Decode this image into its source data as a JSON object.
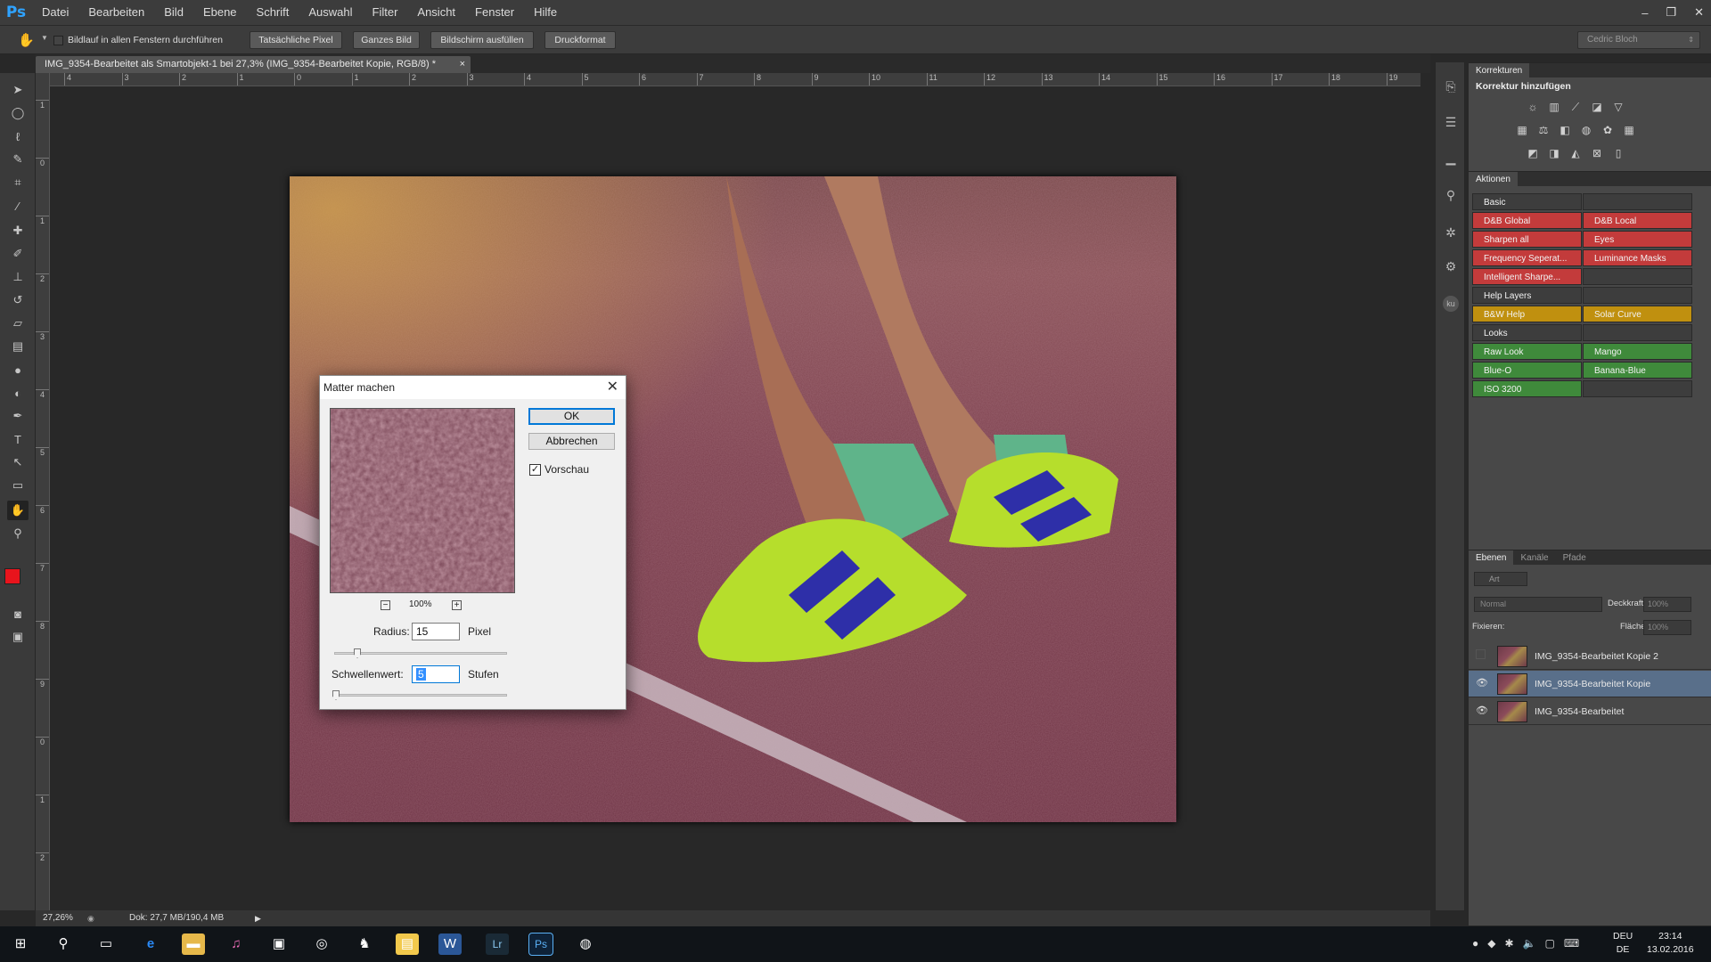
{
  "app": {
    "logo": "Ps"
  },
  "menu": [
    "Datei",
    "Bearbeiten",
    "Bild",
    "Ebene",
    "Schrift",
    "Auswahl",
    "Filter",
    "Ansicht",
    "Fenster",
    "Hilfe"
  ],
  "window_controls": {
    "minimize": "–",
    "restore": "❐",
    "close": "✕"
  },
  "options_bar": {
    "scroll_all_label": "Bildlauf in allen Fenstern durchführen",
    "buttons": [
      "Tatsächliche Pixel",
      "Ganzes Bild",
      "Bildschirm ausfüllen",
      "Druckformat"
    ],
    "user": "Cedric Bloch"
  },
  "document": {
    "tab_title": "IMG_9354-Bearbeitet als Smartobjekt-1 bei 27,3% (IMG_9354-Bearbeitet Kopie, RGB/8) *",
    "tab_close": "×"
  },
  "ruler_h": [
    "4",
    "3",
    "2",
    "1",
    "0",
    "1",
    "2",
    "3",
    "4",
    "5",
    "6",
    "7",
    "8",
    "9",
    "10",
    "11",
    "12",
    "13",
    "14",
    "15",
    "16",
    "17",
    "18",
    "19"
  ],
  "ruler_v": [
    "1",
    "0",
    "1",
    "2",
    "3",
    "4",
    "5",
    "6",
    "7",
    "8",
    "9",
    "0",
    "1",
    "2"
  ],
  "status": {
    "zoom": "27,26%",
    "doc": "Dok: 27,7 MB/190,4 MB"
  },
  "dialog": {
    "title": "Matter machen",
    "ok": "OK",
    "cancel": "Abbrechen",
    "preview_label": "Vorschau",
    "preview_checked": true,
    "zoom": "100%",
    "zoom_minus": "−",
    "zoom_plus": "+",
    "radius_label": "Radius:",
    "radius_value": "15",
    "radius_unit": "Pixel",
    "threshold_label": "Schwellenwert:",
    "threshold_value": "5",
    "threshold_unit": "Stufen"
  },
  "corrections": {
    "tab": "Korrekturen",
    "heading": "Korrektur hinzufügen"
  },
  "actions": {
    "tab": "Aktionen",
    "rows": [
      {
        "left": "Basic",
        "right": "",
        "lc": "#3d3d3d",
        "rc": "#3d3d3d"
      },
      {
        "left": "D&B Global",
        "right": "D&B Local",
        "lc": "#c33b3b",
        "rc": "#c33b3b"
      },
      {
        "left": "Sharpen all",
        "right": "Eyes",
        "lc": "#c33b3b",
        "rc": "#c33b3b"
      },
      {
        "left": "Frequency Seperat...",
        "right": "Luminance Masks",
        "lc": "#c33b3b",
        "rc": "#c33b3b"
      },
      {
        "left": "Intelligent Sharpe...",
        "right": "",
        "lc": "#c33b3b",
        "rc": "#3d3d3d"
      },
      {
        "left": "Help Layers",
        "right": "",
        "lc": "#3d3d3d",
        "rc": "#3d3d3d"
      },
      {
        "left": "B&W Help",
        "right": "Solar Curve",
        "lc": "#c0900f",
        "rc": "#c0900f"
      },
      {
        "left": "Looks",
        "right": "",
        "lc": "#3d3d3d",
        "rc": "#3d3d3d"
      },
      {
        "left": "Raw Look",
        "right": "Mango",
        "lc": "#3f8a3b",
        "rc": "#3f8a3b"
      },
      {
        "left": "Blue-O",
        "right": "Banana-Blue",
        "lc": "#3f8a3b",
        "rc": "#3f8a3b"
      },
      {
        "left": "ISO 3200",
        "right": "",
        "lc": "#3f8a3b",
        "rc": "#3d3d3d"
      }
    ]
  },
  "layers_panel": {
    "tabs": [
      "Ebenen",
      "Kanäle",
      "Pfade"
    ],
    "filter": "Art",
    "blend_mode": "Normal",
    "opacity_label": "Deckkraft:",
    "opacity_value": "100%",
    "lock_label": "Fixieren:",
    "fill_label": "Fläche:",
    "fill_value": "100%",
    "layers": [
      {
        "name": "IMG_9354-Bearbeitet Kopie 2",
        "visible": false,
        "selected": false
      },
      {
        "name": "IMG_9354-Bearbeitet Kopie",
        "visible": true,
        "selected": true
      },
      {
        "name": "IMG_9354-Bearbeitet",
        "visible": true,
        "selected": false
      }
    ]
  },
  "taskbar": {
    "time": "23:14",
    "date": "13.02.2016",
    "lang1": "DEU",
    "lang2": "DE"
  },
  "colors": {
    "foreground": "#e8141c",
    "background": "#ffffff",
    "accent": "#2fa3ff"
  }
}
